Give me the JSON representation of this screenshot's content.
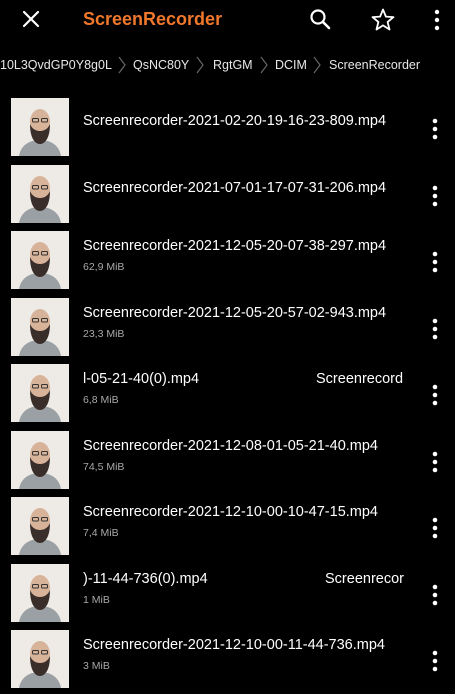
{
  "appbar": {
    "title": "ScreenRecorder",
    "icons": [
      "close-icon",
      "search-icon",
      "star-icon",
      "more-vert-icon"
    ],
    "accent_color": "#f0782d"
  },
  "breadcrumb": [
    "10L3QvdGP0Y8g0L",
    "QsNC80Y",
    "RgtGM",
    "DCIM",
    "ScreenRecorder"
  ],
  "files": [
    {
      "name": "Screenrecorder-2021-02-20-19-16-23-809.mp4",
      "size": ""
    },
    {
      "name": "Screenrecorder-2021-07-01-17-07-31-206.mp4",
      "size": ""
    },
    {
      "name": "Screenrecorder-2021-12-05-20-07-38-297.mp4",
      "size": "62,9 MiB"
    },
    {
      "name": "Screenrecorder-2021-12-05-20-57-02-943.mp4",
      "size": "23,3 MiB"
    },
    {
      "name_part1": "l-05-21-40(0).mp4",
      "name_part2": "Screenrecord",
      "size": "6,8 MiB"
    },
    {
      "name": "Screenrecorder-2021-12-08-01-05-21-40.mp4",
      "size": "74,5 MiB"
    },
    {
      "name": "Screenrecorder-2021-12-10-00-10-47-15.mp4",
      "size": "7,4 MiB"
    },
    {
      "name_part1": ")-11-44-736(0).mp4",
      "name_part2": "Screenrecor",
      "size": "1 MiB"
    },
    {
      "name": "Screenrecorder-2021-12-10-00-11-44-736.mp4",
      "size": "3 MiB"
    }
  ]
}
